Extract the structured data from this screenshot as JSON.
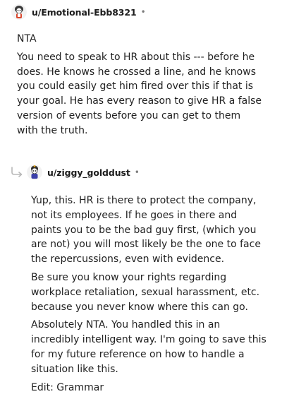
{
  "comments": [
    {
      "username": "u/Emotional-Ebb8321",
      "separator": "•",
      "paragraphs": [
        "NTA",
        "You need to speak to HR about this --- before he does. He knows he crossed a line, and he knows you could easily get him fired over this if that is your goal. He has every reason to give HR a false version of events before you can get to them with the truth."
      ]
    },
    {
      "username": "u/ziggy_golddust",
      "separator": "•",
      "paragraphs": [
        "Yup, this. HR is there to protect the company, not its employees. If he goes in there and paints you to be the bad guy first, (which you are not) you will most likely be the one to face the repercussions, even with evidence.",
        "Be sure you know your rights regarding workplace retaliation, sexual harassment, etc. because you never know where this can go.",
        "Absolutely NTA. You handled this in an incredibly intelligent way. I'm going to save this for my future reference on how to handle a situation like this.",
        "Edit: Grammar"
      ]
    }
  ]
}
